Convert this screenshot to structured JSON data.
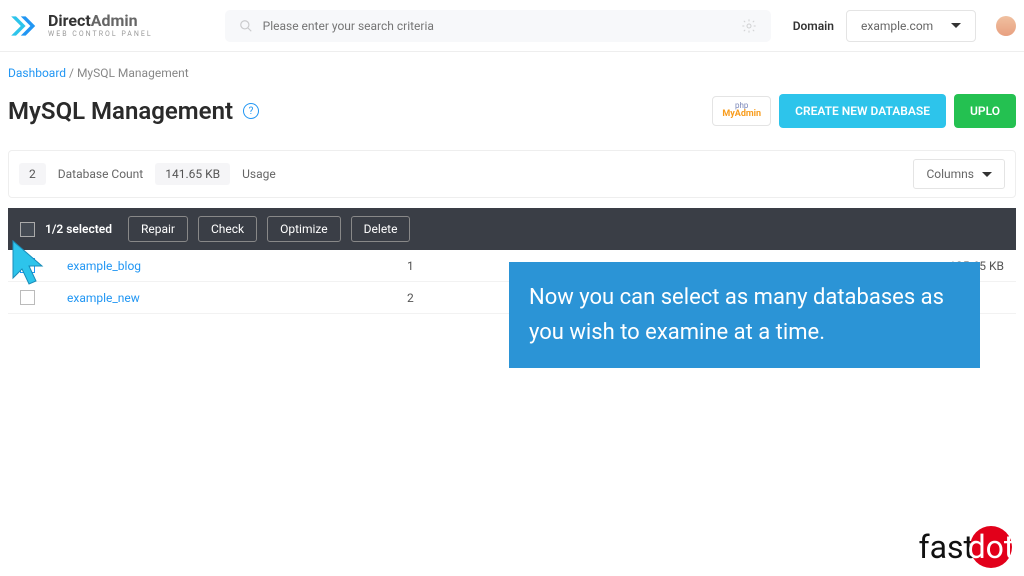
{
  "brand": {
    "direct": "Direct",
    "admin": "Admin",
    "sub": "WEB CONTROL PANEL"
  },
  "search": {
    "placeholder": "Please enter your search criteria"
  },
  "domain": {
    "label": "Domain",
    "value": "example.com"
  },
  "breadcrumb": {
    "root": "Dashboard",
    "sep": " / ",
    "current": "MySQL Management"
  },
  "page": {
    "title": "MySQL Management",
    "help": "?"
  },
  "actions": {
    "phpmyadmin_top": "php",
    "phpmyadmin_bottom": "MyAdmin",
    "create": "CREATE NEW DATABASE",
    "upload": "UPLO"
  },
  "stats": {
    "count": "2",
    "count_label": "Database Count",
    "kb": "141.65 KB",
    "usage": "Usage",
    "columns": "Columns"
  },
  "toolbar": {
    "selected": "1/2 selected",
    "repair": "Repair",
    "check": "Check",
    "optimize": "Optimize",
    "delete": "Delete"
  },
  "rows": {
    "r0": {
      "name": "example_blog",
      "num": "1",
      "size": "125.65 KB"
    },
    "r1": {
      "name": "example_new",
      "num": "2",
      "size": ""
    }
  },
  "tooltip": "Now you can select as many databases as you wish to examine at a time.",
  "fastdot": {
    "fast": "fast",
    "dot": "dot"
  }
}
